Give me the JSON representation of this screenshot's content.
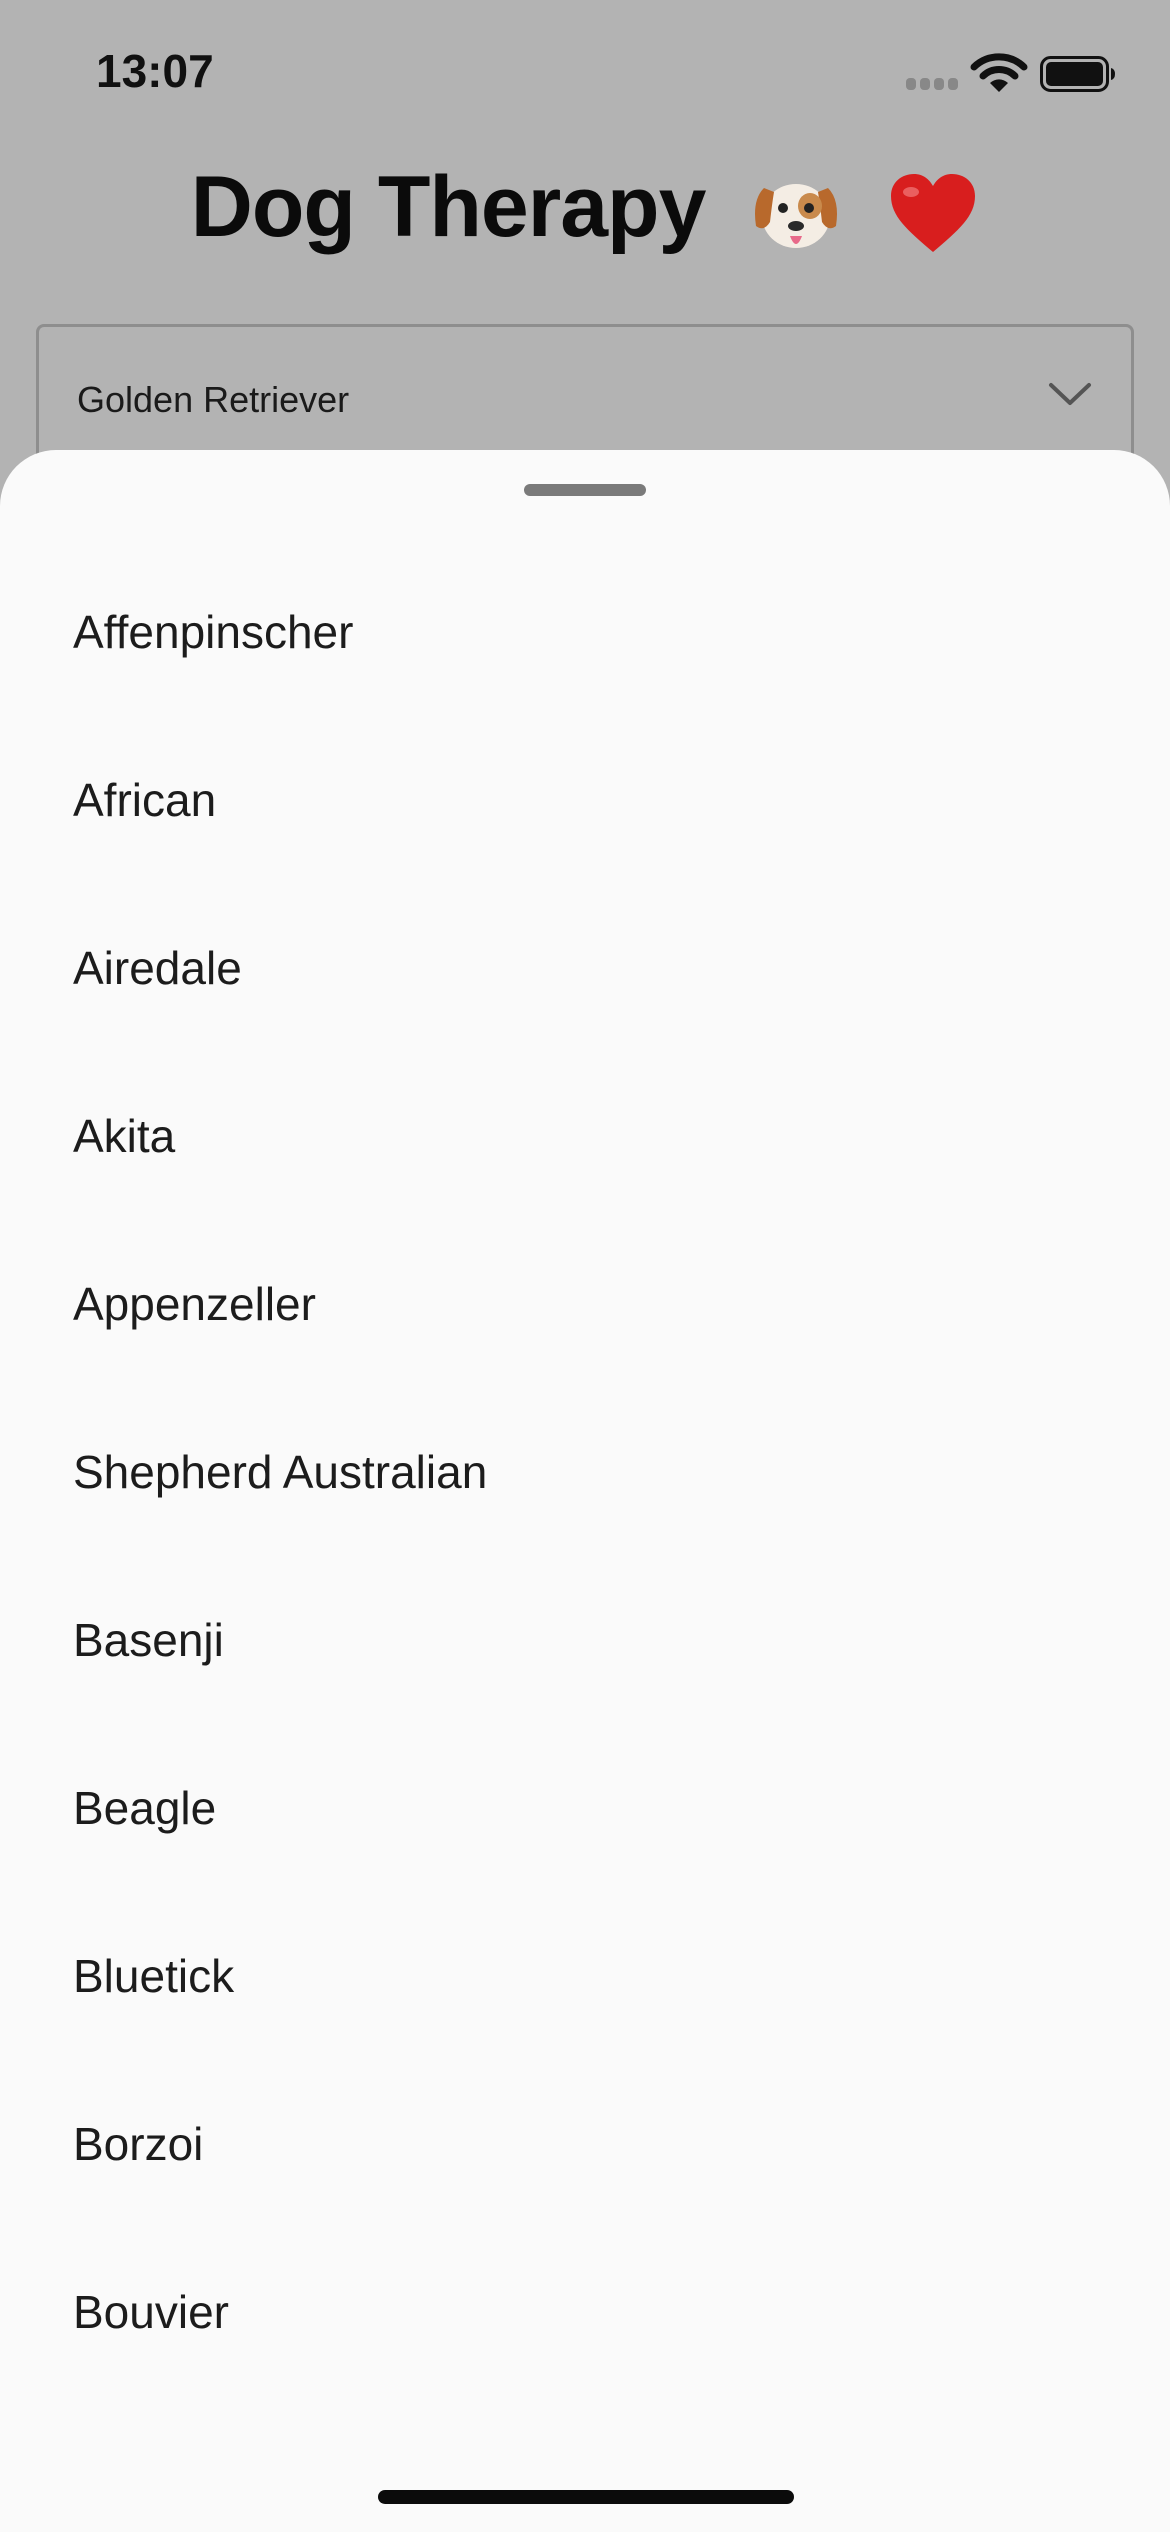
{
  "status_bar": {
    "time": "13:07",
    "icons": [
      "signal-icon",
      "wifi-icon",
      "battery-icon"
    ]
  },
  "header": {
    "title": "Dog Therapy",
    "emoji_icons": [
      "dog-face-icon",
      "red-heart-icon"
    ]
  },
  "breed_select": {
    "value": "Golden Retriever",
    "icon": "chevron-down-icon"
  },
  "breed_sheet": {
    "items": [
      {
        "label": "Affenpinscher"
      },
      {
        "label": "African"
      },
      {
        "label": "Airedale"
      },
      {
        "label": "Akita"
      },
      {
        "label": "Appenzeller"
      },
      {
        "label": "Shepherd Australian"
      },
      {
        "label": "Basenji"
      },
      {
        "label": "Beagle"
      },
      {
        "label": "Bluetick"
      },
      {
        "label": "Borzoi"
      },
      {
        "label": "Bouvier"
      }
    ]
  },
  "colors": {
    "overlay_background": "#b3b3b3",
    "sheet_background": "#fafafa",
    "text": "#1c1c1c",
    "heart": "#d81e1e",
    "dog_ear": "#b8692c"
  }
}
